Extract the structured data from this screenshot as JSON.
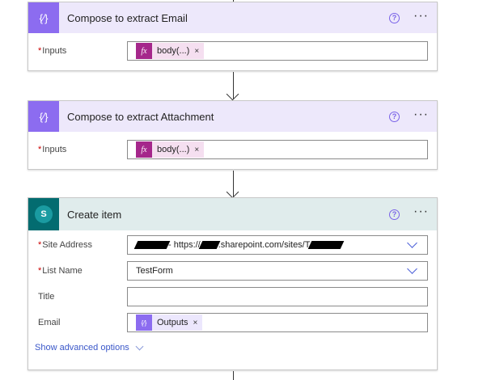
{
  "cards": [
    {
      "title": "Compose to extract Email",
      "inputs_label": "Inputs",
      "token": "body(...)"
    },
    {
      "title": "Compose to extract Attachment",
      "inputs_label": "Inputs",
      "token": "body(...)"
    }
  ],
  "create_item": {
    "title": "Create item",
    "site_address_label": "Site Address",
    "site_address_mid": " - https://",
    "site_address_domain": ".sharepoint.com/sites/T",
    "list_name_label": "List Name",
    "list_name_value": "TestForm",
    "title_label": "Title",
    "email_label": "Email",
    "email_token": "Outputs",
    "advanced": "Show advanced options"
  },
  "icons": {
    "help": "?",
    "more": "···",
    "remove": "×",
    "compose": "{∕}",
    "fx": "fx",
    "sharepoint": "S"
  },
  "colors": {
    "compose": "#8c6cf0",
    "sharepoint": "#036c70",
    "fx": "#a5278b",
    "link": "#3a57c9"
  }
}
